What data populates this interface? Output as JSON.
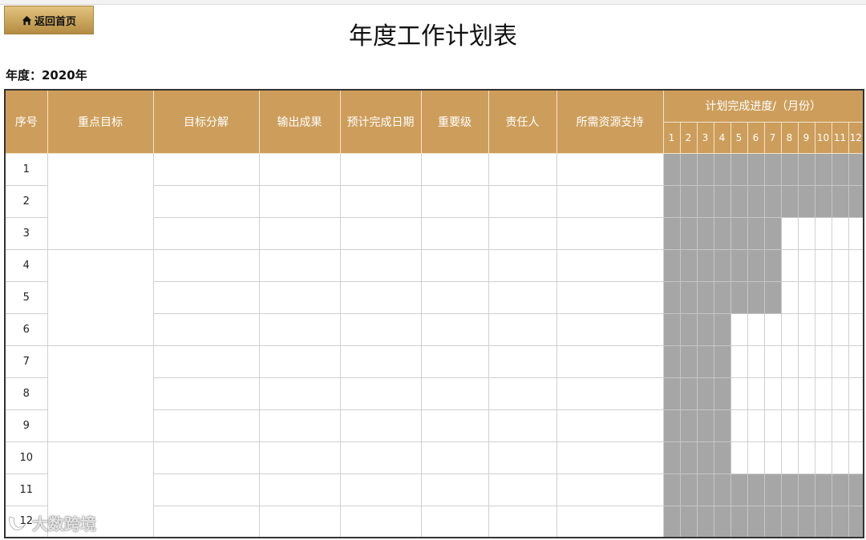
{
  "nav": {
    "home_label": "返回首页",
    "home_icon": "home-icon"
  },
  "header": {
    "title": "年度工作计划表",
    "year_label": "年度：2020年"
  },
  "table": {
    "columns": {
      "index": "序号",
      "key_goal": "重点目标",
      "goal_breakdown": "目标分解",
      "output": "输出成果",
      "expected_date": "预计完成日期",
      "priority": "重要级",
      "owner": "责任人",
      "resources": "所需资源支持",
      "progress": "计划完成进度/（月份）"
    },
    "months": [
      "1",
      "2",
      "3",
      "4",
      "5",
      "6",
      "7",
      "8",
      "9",
      "10",
      "11",
      "12"
    ],
    "rows": [
      {
        "index": "1",
        "months_done": 12
      },
      {
        "index": "2",
        "months_done": 12
      },
      {
        "index": "3",
        "months_done": 7
      },
      {
        "index": "4",
        "months_done": 7
      },
      {
        "index": "5",
        "months_done": 7
      },
      {
        "index": "6",
        "months_done": 4
      },
      {
        "index": "7",
        "months_done": 4
      },
      {
        "index": "8",
        "months_done": 4
      },
      {
        "index": "9",
        "months_done": 4
      },
      {
        "index": "10",
        "months_done": 4
      },
      {
        "index": "11",
        "months_done": 12
      },
      {
        "index": "12",
        "months_done": 12
      }
    ],
    "key_goal_group_size": 3
  },
  "colors": {
    "header_bg": "#cd9e5b",
    "progress_fill": "#a6a6a6",
    "button_gold": "#c9a55c"
  },
  "watermark": {
    "text": "大数跨境",
    "icon": "logo-mark-icon"
  }
}
